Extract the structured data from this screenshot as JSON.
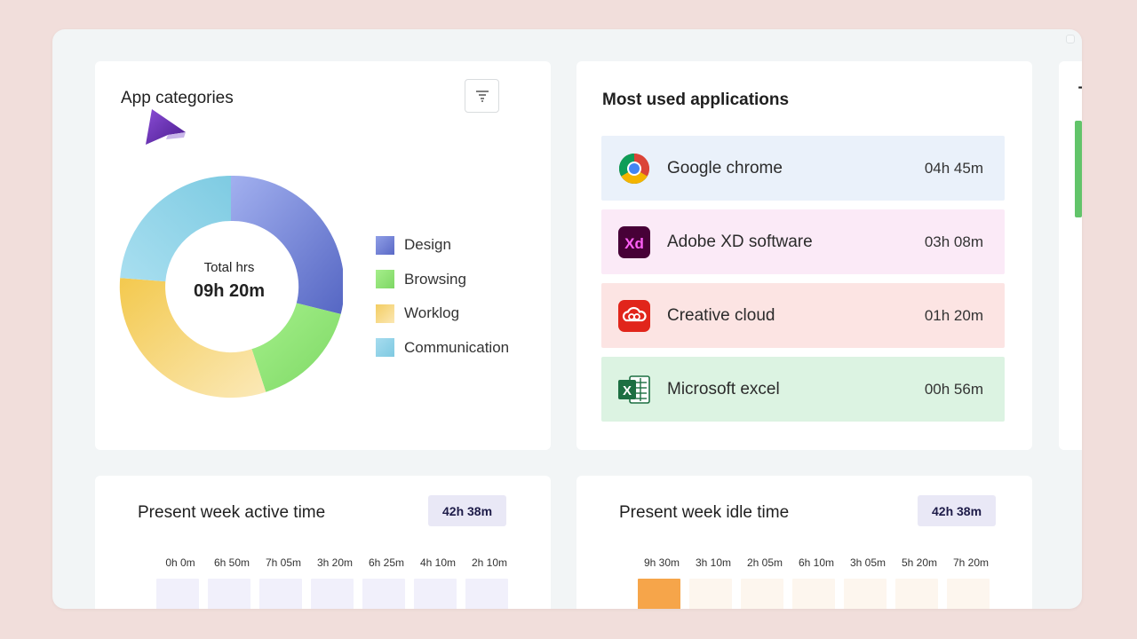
{
  "categories_card": {
    "title": "App categories",
    "total_label": "Total hrs",
    "total_value": "09h 20m",
    "legend": [
      {
        "label": "Design",
        "color": "#6f7fd3"
      },
      {
        "label": "Browsing",
        "color": "#8ee26f"
      },
      {
        "label": "Worklog",
        "color": "#f6d27a"
      },
      {
        "label": "Communication",
        "color": "#8fd2e6"
      }
    ]
  },
  "apps_card": {
    "title": "Most used applications",
    "items": [
      {
        "name": "Google chrome",
        "time": "04h 45m",
        "icon": "chrome-icon",
        "bg": "#eaf1fa"
      },
      {
        "name": "Adobe XD software",
        "time": "03h 08m",
        "icon": "adobe-xd-icon",
        "bg": "#fbeaf7"
      },
      {
        "name": "Creative cloud",
        "time": "01h 20m",
        "icon": "creative-cloud-icon",
        "bg": "#fce4e3"
      },
      {
        "name": "Microsoft excel",
        "time": "00h 56m",
        "icon": "excel-icon",
        "bg": "#dcf3e2"
      }
    ]
  },
  "third_card": {
    "title_peek": "T"
  },
  "active_card": {
    "title": "Present week active time",
    "badge": "42h 38m",
    "days": [
      "0h 0m",
      "6h 50m",
      "7h 05m",
      "3h 20m",
      "6h 25m",
      "4h 10m",
      "2h 10m"
    ]
  },
  "idle_card": {
    "title": "Present week idle time",
    "badge": "42h 38m",
    "days": [
      "9h 30m",
      "3h 10m",
      "2h 05m",
      "6h 10m",
      "3h 05m",
      "5h 20m",
      "7h 20m"
    ]
  },
  "colors": {
    "active_cell": "#f1f0fb",
    "idle_cell_highlight": "#f6a54a",
    "idle_cell": "#fdf6ee"
  }
}
